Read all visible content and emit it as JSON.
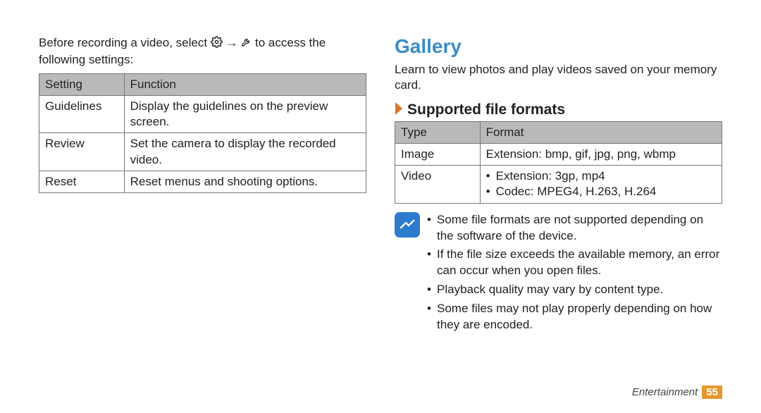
{
  "left": {
    "intro_pre": "Before recording a video, select ",
    "intro_mid": " → ",
    "intro_post": " to access the following settings:",
    "table": {
      "h1": "Setting",
      "h2": "Function",
      "rows": [
        {
          "k": "Guidelines",
          "v": "Display the guidelines on the preview screen."
        },
        {
          "k": "Review",
          "v": "Set the camera to display the recorded video."
        },
        {
          "k": "Reset",
          "v": "Reset menus and shooting options."
        }
      ]
    }
  },
  "right": {
    "title": "Gallery",
    "intro": "Learn to view photos and play videos saved on your memory card.",
    "subhead": "Supported file formats",
    "table": {
      "h1": "Type",
      "h2": "Format",
      "image_k": "Image",
      "image_v": "Extension: bmp, gif, jpg, png, wbmp",
      "video_k": "Video",
      "video_v1": "Extension: 3gp, mp4",
      "video_v2": "Codec: MPEG4, H.263, H.264"
    },
    "notes": [
      "Some file formats are not supported depending on the software of the device.",
      "If the file size exceeds the available memory, an error can occur when you open files.",
      "Playback quality may vary by content type.",
      "Some files may not play properly depending on how they are encoded."
    ]
  },
  "footer": {
    "section": "Entertainment",
    "page": "55"
  }
}
